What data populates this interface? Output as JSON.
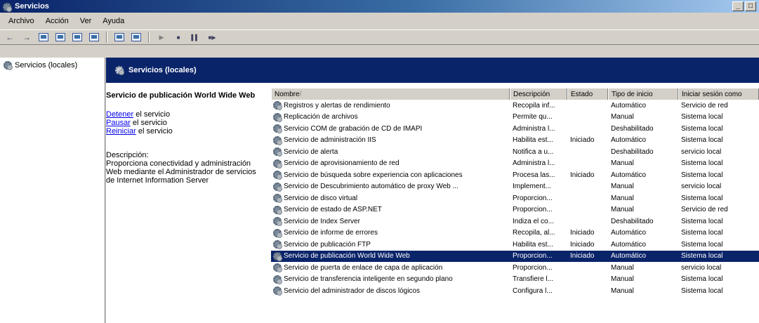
{
  "window": {
    "title": "Servicios",
    "min_label": "_",
    "max_label": "□"
  },
  "menu": [
    "Archivo",
    "Acción",
    "Ver",
    "Ayuda"
  ],
  "tree": {
    "root_label": "Servicios (locales)"
  },
  "header": {
    "title": "Servicios (locales)"
  },
  "detail": {
    "service_title": "Servicio de publicación World Wide Web",
    "stop_link": "Detener",
    "stop_suffix": " el servicio",
    "pause_link": "Pausar",
    "pause_suffix": " el servicio",
    "restart_link": "Reiniciar",
    "restart_suffix": " el servicio",
    "description_label": "Descripción:",
    "description_text": "Proporciona conectividad y administración Web mediante el Administrador de servicios de Internet Information Server"
  },
  "columns": {
    "name": "Nombre",
    "name_sort": " /",
    "description": "Descripción",
    "state": "Estado",
    "startup": "Tipo de inicio",
    "logon": "Iniciar sesión como"
  },
  "rows": [
    {
      "name": "Registros y alertas de rendimiento",
      "description": "Recopila inf...",
      "state": "",
      "startup": "Automático",
      "logon": "Servicio de red",
      "selected": false
    },
    {
      "name": "Replicación de archivos",
      "description": "Permite qu...",
      "state": "",
      "startup": "Manual",
      "logon": "Sistema local",
      "selected": false
    },
    {
      "name": "Servicio COM de grabación de CD de IMAPI",
      "description": "Administra l...",
      "state": "",
      "startup": "Deshabilitado",
      "logon": "Sistema local",
      "selected": false
    },
    {
      "name": "Servicio de administración IIS",
      "description": "Habilita est...",
      "state": "Iniciado",
      "startup": "Automático",
      "logon": "Sistema local",
      "selected": false
    },
    {
      "name": "Servicio de alerta",
      "description": "Notifica a u...",
      "state": "",
      "startup": "Deshabilitado",
      "logon": "servicio local",
      "selected": false
    },
    {
      "name": "Servicio de aprovisionamiento de red",
      "description": "Administra l...",
      "state": "",
      "startup": "Manual",
      "logon": "Sistema local",
      "selected": false
    },
    {
      "name": "Servicio de búsqueda sobre experiencia con aplicaciones",
      "description": "Procesa las...",
      "state": "Iniciado",
      "startup": "Automático",
      "logon": "Sistema local",
      "selected": false
    },
    {
      "name": "Servicio de Descubrimiento automático de proxy Web ...",
      "description": "Implement...",
      "state": "",
      "startup": "Manual",
      "logon": "servicio local",
      "selected": false
    },
    {
      "name": "Servicio de disco virtual",
      "description": "Proporcion...",
      "state": "",
      "startup": "Manual",
      "logon": "Sistema local",
      "selected": false
    },
    {
      "name": "Servicio de estado de ASP.NET",
      "description": "Proporcion...",
      "state": "",
      "startup": "Manual",
      "logon": "Servicio de red",
      "selected": false
    },
    {
      "name": "Servicio de Index Server",
      "description": "Indiza el co...",
      "state": "",
      "startup": "Deshabilitado",
      "logon": "Sistema local",
      "selected": false
    },
    {
      "name": "Servicio de informe de errores",
      "description": "Recopila, al...",
      "state": "Iniciado",
      "startup": "Automático",
      "logon": "Sistema local",
      "selected": false
    },
    {
      "name": "Servicio de publicación FTP",
      "description": "Habilita est...",
      "state": "Iniciado",
      "startup": "Automático",
      "logon": "Sistema local",
      "selected": false
    },
    {
      "name": "Servicio de publicación World Wide Web",
      "description": "Proporcion...",
      "state": "Iniciado",
      "startup": "Automático",
      "logon": "Sistema local",
      "selected": true
    },
    {
      "name": "Servicio de puerta de enlace de capa de aplicación",
      "description": "Proporcion...",
      "state": "",
      "startup": "Manual",
      "logon": "servicio local",
      "selected": false
    },
    {
      "name": "Servicio de transferencia inteligente en segundo plano",
      "description": "Transfiere l...",
      "state": "",
      "startup": "Manual",
      "logon": "Sistema local",
      "selected": false
    },
    {
      "name": "Servicio del administrador de discos lógicos",
      "description": "Configura l...",
      "state": "",
      "startup": "Manual",
      "logon": "Sistema local",
      "selected": false
    }
  ],
  "icons": {
    "service": "gear-icon",
    "colors": {
      "selection": "#0a246a",
      "header": "#0a246a",
      "link": "#0000ee"
    }
  }
}
